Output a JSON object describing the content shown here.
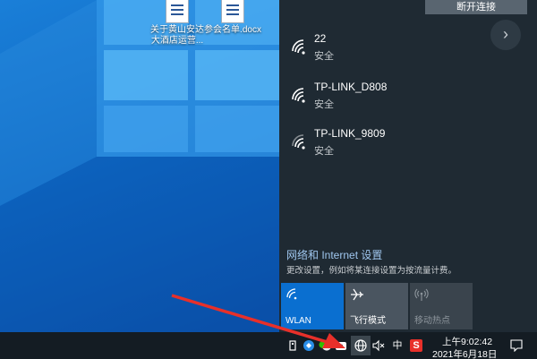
{
  "desktop": {
    "icons": [
      {
        "label": "关于黄山安达大酒店运营...",
        "icon": "word-document-icon"
      },
      {
        "label": "参会名单.docx",
        "icon": "word-document-icon"
      }
    ]
  },
  "network_panel": {
    "disconnect_label": "断开连接",
    "scroll_icon": "chevron-right-icon",
    "networks": [
      {
        "name": "22",
        "status": "安全",
        "icon": "wifi-icon"
      },
      {
        "name": "TP-LINK_D808",
        "status": "安全",
        "icon": "wifi-icon"
      },
      {
        "name": "TP-LINK_9809",
        "status": "安全",
        "icon": "wifi-icon"
      }
    ],
    "settings_title": "网络和 Internet 设置",
    "settings_desc": "更改设置，例如将某连接设置为按流量计费。",
    "quick_actions": [
      {
        "label": "WLAN",
        "icon": "wifi-icon",
        "state": "on"
      },
      {
        "label": "飞行模式",
        "icon": "airplane-icon",
        "state": "off"
      },
      {
        "label": "移动热点",
        "icon": "hotspot-icon",
        "state": "disabled"
      }
    ]
  },
  "taskbar": {
    "ime_label": "中",
    "sogou_label": "S",
    "time": "上午9:02:42",
    "date": "2021年6月18日"
  },
  "colors": {
    "panel_bg": "#1f2a33",
    "accent": "#0a6fd0",
    "taskbar_bg": "#141c23",
    "arrow": "#e8302a"
  }
}
